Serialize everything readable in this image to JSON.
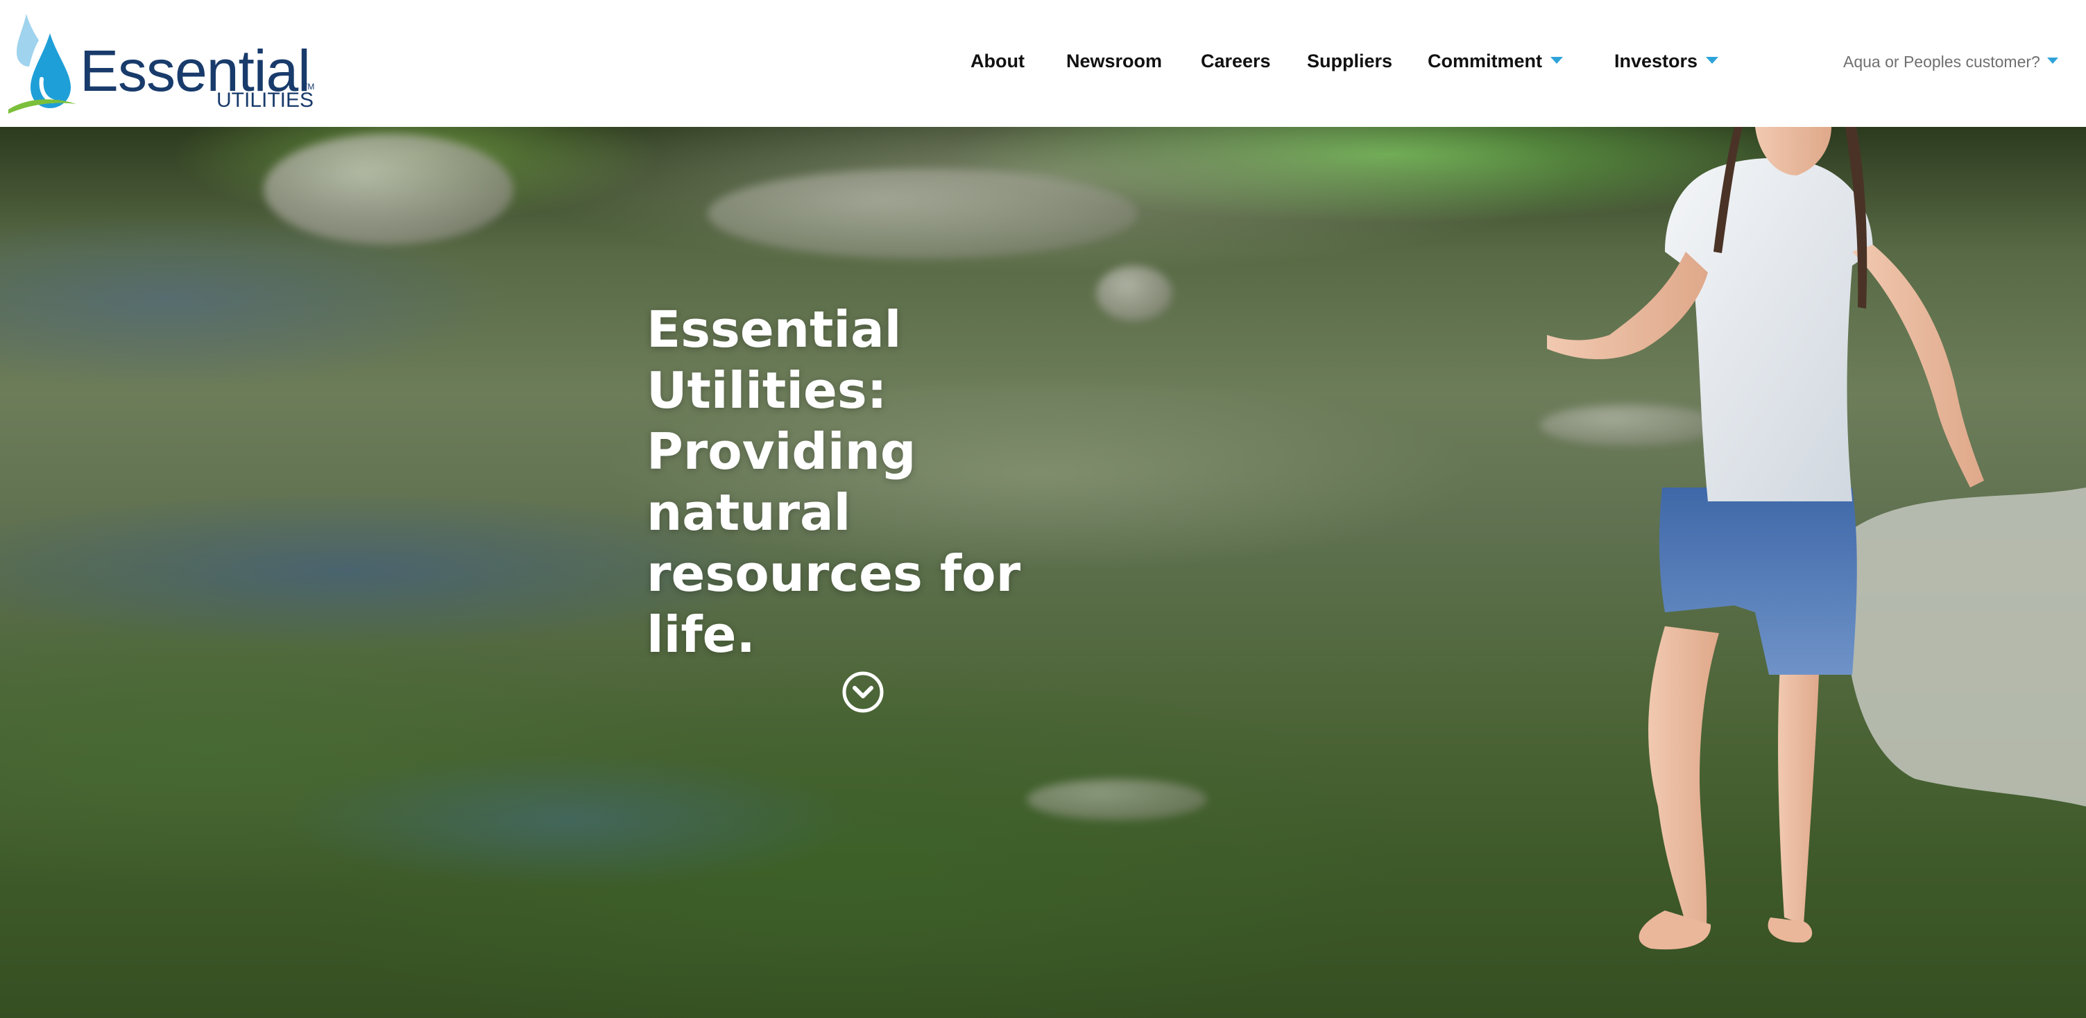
{
  "logo": {
    "name": "Essential",
    "sub": "UTILITIES",
    "tm": "TM"
  },
  "nav": {
    "items": [
      {
        "label": "About",
        "dropdown": false
      },
      {
        "label": "Newsroom",
        "dropdown": false
      },
      {
        "label": "Careers",
        "dropdown": false
      },
      {
        "label": "Suppliers",
        "dropdown": false
      },
      {
        "label": "Commitment",
        "dropdown": true
      },
      {
        "label": "Investors",
        "dropdown": true
      }
    ],
    "customer_label": "Aqua or Peoples customer?"
  },
  "hero": {
    "headline_lines": [
      "Essential",
      "Utilities:",
      "Providing",
      "natural",
      "resources for",
      "life."
    ],
    "scroll_icon": "chevron-down-circle-icon"
  },
  "colors": {
    "brand_navy": "#183b6b",
    "brand_blue": "#2ea3d9",
    "brand_green": "#7bbf3a",
    "caret": "#2ea3d9"
  }
}
